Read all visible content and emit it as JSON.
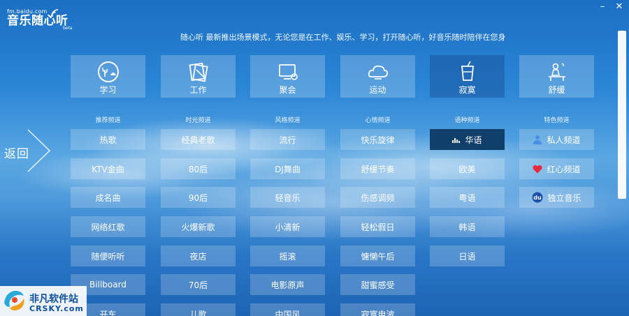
{
  "logo": {
    "url": "fm.baidu.com",
    "name": "音乐随心听",
    "badge": "beta"
  },
  "window_controls": {
    "minimize": "–",
    "close": "✕"
  },
  "tagline": "随心听 最新推出场景模式，无论您是在工作、娱乐、学习，打开随心听，好音乐随时陪伴在您身",
  "scenes": [
    {
      "label": "学习",
      "icon": "globe-plant-icon"
    },
    {
      "label": "工作",
      "icon": "documents-icon"
    },
    {
      "label": "聚会",
      "icon": "tv-icon"
    },
    {
      "label": "运动",
      "icon": "cloud-icon"
    },
    {
      "label": "寂寞",
      "icon": "drink-icon"
    },
    {
      "label": "舒缓",
      "icon": "reading-person-icon"
    }
  ],
  "back_label": "返回",
  "columns": [
    {
      "header": "推荐频道",
      "items": [
        "热歌",
        "KTV金曲",
        "成名曲",
        "网络红歌",
        "随便听听",
        "Billboard",
        "开车"
      ]
    },
    {
      "header": "时光频道",
      "items": [
        "经典老歌",
        "80后",
        "90后",
        "火爆新歌",
        "夜店",
        "70后",
        "儿歌"
      ]
    },
    {
      "header": "风格频道",
      "items": [
        "流行",
        "DJ舞曲",
        "轻音乐",
        "小清新",
        "摇滚",
        "电影原声",
        "中国风"
      ]
    },
    {
      "header": "心情频道",
      "items": [
        "快乐旋律",
        "舒缓节奏",
        "伤感调频",
        "轻松假日",
        "慵懒午后",
        "甜蜜感受",
        "寂寞电波"
      ]
    },
    {
      "header": "语种频道",
      "items": [
        "华语",
        "欧美",
        "粤语",
        "韩语",
        "日语"
      ],
      "active_index": 0
    },
    {
      "header": "特色频道",
      "items": [
        "私人频道",
        "红心频道",
        "独立音乐"
      ],
      "item_icons": [
        "person-icon",
        "heart-icon",
        "du-badge-icon"
      ]
    }
  ],
  "icon_colors": {
    "person": "#4a8ee6",
    "heart": "#e8283c",
    "du_badge": "#1b4fa8",
    "du_text": "#ffffff"
  },
  "du_badge_text": "du",
  "watermark": {
    "text1": "非凡软件站",
    "text2": "CRSKY.com"
  }
}
